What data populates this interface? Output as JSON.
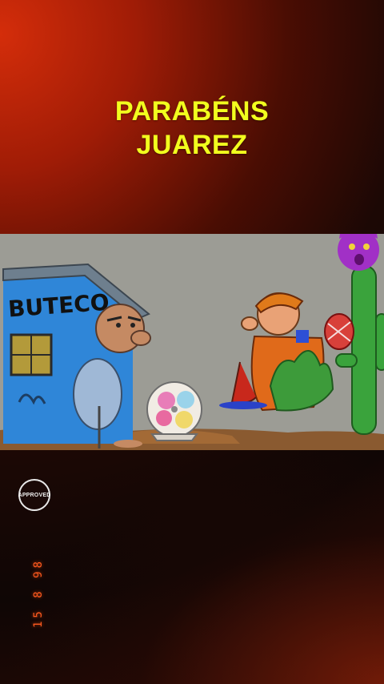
{
  "title": {
    "line1": "PARABÉNS",
    "line2": "JUAREZ"
  },
  "scene": {
    "sign_text": "BUTECO"
  },
  "badge": {
    "label": "APPROVED"
  },
  "stamp": {
    "text": "15 8 98"
  },
  "colors": {
    "title": "#f2ff1e",
    "stamp": "#ff5a1e",
    "accent": "#d42d0a"
  }
}
